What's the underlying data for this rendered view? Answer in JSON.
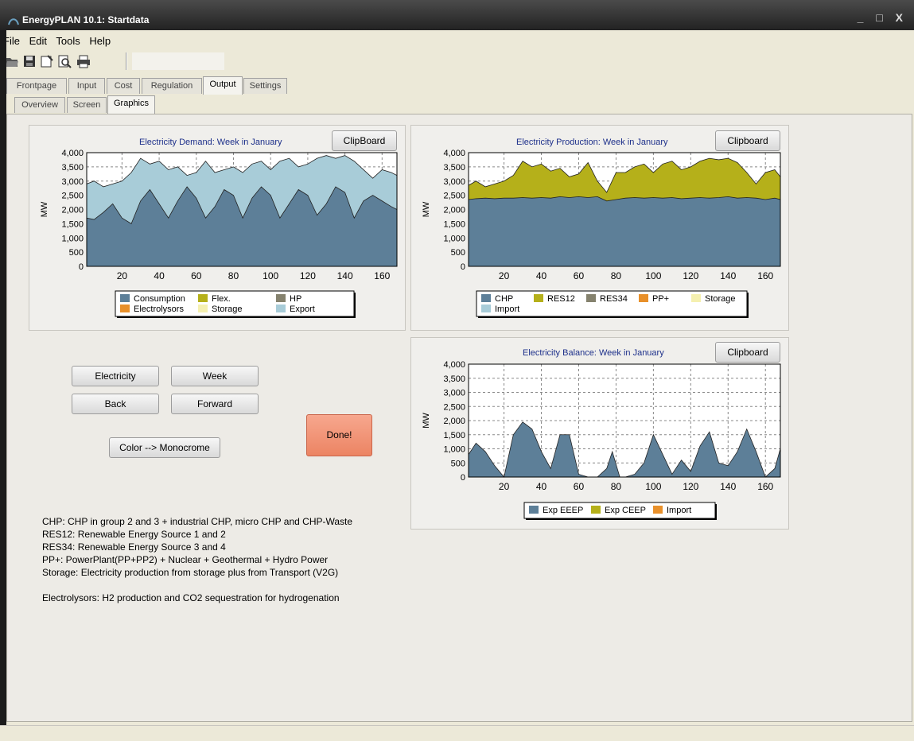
{
  "window": {
    "title": "EnergyPLAN 10.1: Startdata",
    "controls": "_ □ X"
  },
  "menu": [
    "File",
    "Edit",
    "Tools",
    "Help"
  ],
  "toolbar": [
    "open-icon",
    "save-icon",
    "properties-icon",
    "print-preview-icon",
    "print-icon"
  ],
  "main_tabs": [
    "Frontpage",
    "Input",
    "Cost",
    "Regulation",
    "Output",
    "Settings"
  ],
  "main_tab_active": "Output",
  "sub_tabs": [
    "Overview",
    "Screen",
    "Graphics"
  ],
  "sub_tab_active": "Graphics",
  "buttons": {
    "electricity": "Electricity",
    "week": "Week",
    "back": "Back",
    "forward": "Forward",
    "color_mono": "Color --> Monocrome",
    "done": "Done!"
  },
  "notes": [
    "CHP: CHP in group 2 and 3 + industrial CHP, micro CHP and CHP-Waste",
    "RES12: Renewable Energy Source 1 and 2",
    "RES34: Renewable Energy Source 3 and 4",
    "PP+: PowerPlant(PP+PP2) + Nuclear + Geothermal + Hydro Power",
    "Storage: Electricity production from storage plus from Transport (V2G)",
    "",
    "Electrolysors: H2 production and CO2 sequestration for hydrogenation"
  ],
  "colors": {
    "blue": "#5d7f98",
    "olive": "#b5b01a",
    "gray": "#85826e",
    "orange": "#e8902a",
    "paleyellow": "#f5f0b0",
    "lightblue": "#a8ccd8"
  },
  "chart_data": [
    {
      "id": "demand",
      "type": "area",
      "title": "Electricity Demand: Week in January",
      "button": "ClipBoard",
      "ylabel": "MW",
      "ylim": [
        0,
        4000
      ],
      "yticks": [
        "4,000",
        "3,500",
        "3,000",
        "2,500",
        "2,000",
        "1,500",
        "1,000",
        "500",
        "0"
      ],
      "xlim": [
        1,
        168
      ],
      "xticks": [
        "20",
        "40",
        "60",
        "80",
        "100",
        "120",
        "140",
        "160"
      ],
      "legend": [
        {
          "label": "Consumption",
          "color": "#5d7f98"
        },
        {
          "label": "Flex.",
          "color": "#b5b01a"
        },
        {
          "label": "HP",
          "color": "#85826e"
        },
        {
          "label": "Electrolysors",
          "color": "#e8902a"
        },
        {
          "label": "Storage",
          "color": "#f5f0b0"
        },
        {
          "label": "Export",
          "color": "#a8ccd8"
        }
      ],
      "x": [
        1,
        5,
        10,
        15,
        20,
        25,
        30,
        35,
        40,
        45,
        50,
        55,
        60,
        65,
        70,
        75,
        80,
        85,
        90,
        95,
        100,
        105,
        110,
        115,
        120,
        125,
        130,
        135,
        140,
        145,
        150,
        155,
        160,
        165,
        168
      ],
      "series": [
        {
          "name": "Consumption",
          "values": [
            1700,
            1650,
            1900,
            2200,
            1700,
            1500,
            2300,
            2700,
            2200,
            1700,
            2300,
            2800,
            2400,
            1700,
            2100,
            2700,
            2500,
            1700,
            2400,
            2800,
            2500,
            1700,
            2200,
            2700,
            2500,
            1800,
            2200,
            2800,
            2600,
            1700,
            2300,
            2500,
            2300,
            2100,
            2000
          ]
        },
        {
          "name": "Export",
          "values": [
            2900,
            3000,
            2800,
            2900,
            3000,
            3300,
            3800,
            3600,
            3700,
            3400,
            3500,
            3200,
            3300,
            3700,
            3300,
            3400,
            3500,
            3300,
            3600,
            3700,
            3400,
            3700,
            3800,
            3500,
            3600,
            3800,
            3900,
            3800,
            3900,
            3700,
            3400,
            3100,
            3400,
            3300,
            3200
          ]
        }
      ]
    },
    {
      "id": "production",
      "type": "area",
      "title": "Electricity Production: Week in January",
      "button": "Clipboard",
      "ylabel": "MW",
      "ylim": [
        0,
        4000
      ],
      "yticks": [
        "4,000",
        "3,500",
        "3,000",
        "2,500",
        "2,000",
        "1,500",
        "1,000",
        "500",
        "0"
      ],
      "xlim": [
        1,
        168
      ],
      "xticks": [
        "20",
        "40",
        "60",
        "80",
        "100",
        "120",
        "140",
        "160"
      ],
      "legend": [
        {
          "label": "CHP",
          "color": "#5d7f98"
        },
        {
          "label": "RES12",
          "color": "#b5b01a"
        },
        {
          "label": "RES34",
          "color": "#85826e"
        },
        {
          "label": "PP+",
          "color": "#e8902a"
        },
        {
          "label": "Storage",
          "color": "#f5f0b0"
        },
        {
          "label": "Import",
          "color": "#a8ccd8"
        }
      ],
      "x": [
        1,
        5,
        10,
        15,
        20,
        25,
        30,
        35,
        40,
        45,
        50,
        55,
        60,
        65,
        70,
        75,
        80,
        85,
        90,
        95,
        100,
        105,
        110,
        115,
        120,
        125,
        130,
        135,
        140,
        145,
        150,
        155,
        160,
        165,
        168
      ],
      "series": [
        {
          "name": "CHP",
          "values": [
            2350,
            2380,
            2400,
            2380,
            2400,
            2400,
            2420,
            2400,
            2420,
            2400,
            2450,
            2420,
            2450,
            2420,
            2450,
            2300,
            2350,
            2400,
            2420,
            2400,
            2420,
            2400,
            2420,
            2380,
            2400,
            2420,
            2400,
            2420,
            2450,
            2400,
            2420,
            2400,
            2350,
            2400,
            2350
          ]
        },
        {
          "name": "RES12",
          "values": [
            2850,
            3000,
            2800,
            2900,
            3000,
            3200,
            3700,
            3500,
            3600,
            3350,
            3450,
            3150,
            3250,
            3650,
            3000,
            2600,
            3300,
            3300,
            3500,
            3600,
            3300,
            3600,
            3700,
            3400,
            3500,
            3700,
            3800,
            3750,
            3800,
            3650,
            3300,
            2900,
            3300,
            3400,
            3150
          ]
        }
      ]
    },
    {
      "id": "balance",
      "type": "area",
      "title": "Electricity Balance: Week in January",
      "button": "Clipboard",
      "ylabel": "MW",
      "ylim": [
        0,
        4000
      ],
      "yticks": [
        "4,000",
        "3,500",
        "3,000",
        "2,500",
        "2,000",
        "1,500",
        "1,000",
        "500",
        "0"
      ],
      "xlim": [
        1,
        168
      ],
      "xticks": [
        "20",
        "40",
        "60",
        "80",
        "100",
        "120",
        "140",
        "160"
      ],
      "legend": [
        {
          "label": "Exp EEEP",
          "color": "#5d7f98"
        },
        {
          "label": "Exp CEEP",
          "color": "#b5b01a"
        },
        {
          "label": "Import",
          "color": "#e8902a"
        }
      ],
      "x": [
        1,
        5,
        10,
        15,
        20,
        25,
        30,
        35,
        40,
        45,
        50,
        55,
        60,
        65,
        70,
        75,
        78,
        82,
        85,
        90,
        95,
        100,
        105,
        110,
        115,
        120,
        125,
        130,
        135,
        140,
        145,
        150,
        155,
        160,
        165,
        168
      ],
      "series": [
        {
          "name": "Exp EEEP",
          "values": [
            800,
            1200,
            900,
            400,
            0,
            1500,
            1950,
            1700,
            900,
            300,
            1500,
            1500,
            100,
            0,
            0,
            300,
            900,
            0,
            0,
            100,
            500,
            1500,
            800,
            100,
            600,
            200,
            1100,
            1600,
            500,
            400,
            900,
            1700,
            900,
            0,
            300,
            1000
          ]
        }
      ]
    }
  ]
}
